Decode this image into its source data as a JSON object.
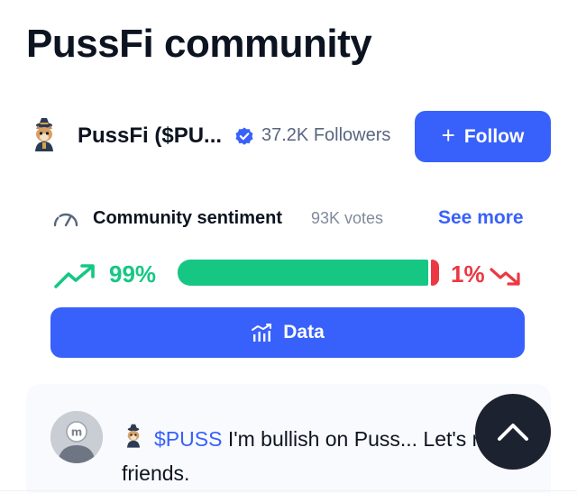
{
  "page": {
    "title": "PussFi community"
  },
  "community": {
    "name": "PussFi ($PU...",
    "followers": "37.2K Followers",
    "follow_label": "Follow",
    "avatar_icon": "cat-wizard-avatar",
    "verified_icon": "verified-badge-icon"
  },
  "sentiment": {
    "label": "Community sentiment",
    "votes": "93K votes",
    "see_more": "See more",
    "bullish_text": "99%",
    "bearish_text": "1%",
    "bullish_fraction": 0.97,
    "bearish_fraction": 0.03
  },
  "data_button": {
    "label": "Data"
  },
  "post": {
    "ticker": "$PUSS",
    "text": " I'm bullish on Puss... Let's ride friends."
  },
  "colors": {
    "accent": "#3861fb",
    "bullish": "#16c784",
    "bearish": "#ea3943",
    "text": "#0d1421",
    "muted": "#58667e",
    "scroll_button": "#1c2230"
  }
}
